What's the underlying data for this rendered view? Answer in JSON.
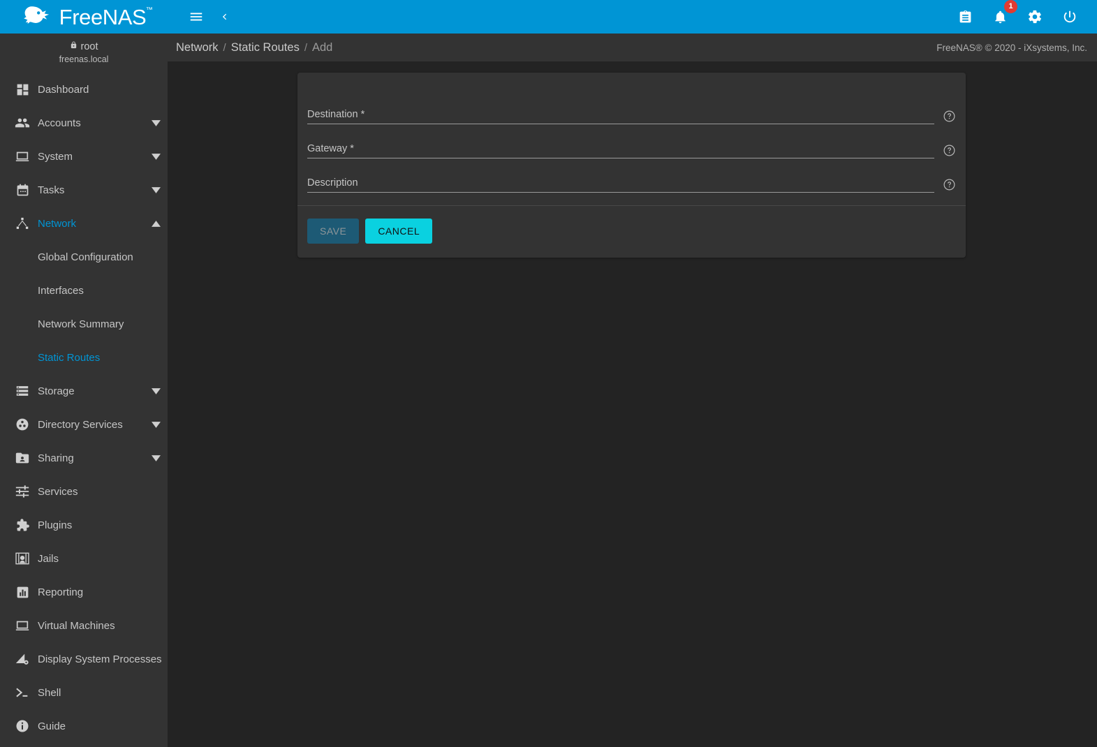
{
  "brand": {
    "name": "FreeNAS",
    "trademark": "™",
    "logo_icon": "freenas-shark-logo",
    "header_color": "#0095d5"
  },
  "topbar": {
    "menu_toggle_icon": "hamburger-menu-icon",
    "collapse_icon": "chevron-left-icon",
    "right_icons": [
      {
        "name": "clipboard-tasks-icon",
        "glyph": "clipboard"
      },
      {
        "name": "notifications-bell-icon",
        "glyph": "bell",
        "badge": "1",
        "badge_color": "#e13b31"
      },
      {
        "name": "settings-gear-icon",
        "glyph": "gear"
      },
      {
        "name": "power-icon",
        "glyph": "power"
      }
    ]
  },
  "sidebar": {
    "user": {
      "name": "root",
      "lock_icon": "lock-icon",
      "host": "freenas.local"
    },
    "items": [
      {
        "label": "Dashboard",
        "icon": "dashboard-icon",
        "expandable": false,
        "active": false
      },
      {
        "label": "Accounts",
        "icon": "accounts-people-icon",
        "expandable": true,
        "active": false
      },
      {
        "label": "System",
        "icon": "system-laptop-icon",
        "expandable": true,
        "active": false
      },
      {
        "label": "Tasks",
        "icon": "tasks-calendar-icon",
        "expandable": true,
        "active": false
      },
      {
        "label": "Network",
        "icon": "network-hub-icon",
        "expandable": true,
        "active": true,
        "expanded": true
      },
      {
        "label": "Storage",
        "icon": "storage-list-icon",
        "expandable": true,
        "active": false
      },
      {
        "label": "Directory Services",
        "icon": "directory-services-icon",
        "expandable": true,
        "active": false
      },
      {
        "label": "Sharing",
        "icon": "sharing-folder-icon",
        "expandable": true,
        "active": false
      },
      {
        "label": "Services",
        "icon": "services-sliders-icon",
        "expandable": false,
        "active": false
      },
      {
        "label": "Plugins",
        "icon": "plugins-puzzle-icon",
        "expandable": false,
        "active": false
      },
      {
        "label": "Jails",
        "icon": "jails-icon",
        "expandable": false,
        "active": false
      },
      {
        "label": "Reporting",
        "icon": "reporting-chart-icon",
        "expandable": false,
        "active": false
      },
      {
        "label": "Virtual Machines",
        "icon": "virtual-machines-laptop-icon",
        "expandable": false,
        "active": false
      },
      {
        "label": "Display System Processes",
        "icon": "system-processes-icon",
        "expandable": false,
        "active": false
      },
      {
        "label": "Shell",
        "icon": "shell-prompt-icon",
        "expandable": false,
        "active": false
      },
      {
        "label": "Guide",
        "icon": "guide-info-icon",
        "expandable": false,
        "active": false
      }
    ],
    "network_subitems": [
      {
        "label": "Global Configuration",
        "active": false
      },
      {
        "label": "Interfaces",
        "active": false
      },
      {
        "label": "Network Summary",
        "active": false
      },
      {
        "label": "Static Routes",
        "active": true
      }
    ],
    "active_color": "#0095d5"
  },
  "breadcrumb": {
    "items": [
      "Network",
      "Static Routes",
      "Add"
    ],
    "separator": "/"
  },
  "footer": {
    "copyright": "FreeNAS® © 2020 - iXsystems, Inc."
  },
  "form": {
    "fields": [
      {
        "label": "Destination *",
        "value": "",
        "placeholder": "",
        "help_icon": "help-circle-icon"
      },
      {
        "label": "Gateway *",
        "value": "",
        "placeholder": "",
        "help_icon": "help-circle-icon"
      },
      {
        "label": "Description",
        "value": "",
        "placeholder": "",
        "help_icon": "help-circle-icon"
      }
    ],
    "buttons": {
      "save_label": "SAVE",
      "save_enabled": false,
      "save_color": "#1d5a75",
      "cancel_label": "CANCEL",
      "cancel_color": "#0ad1e0"
    }
  }
}
